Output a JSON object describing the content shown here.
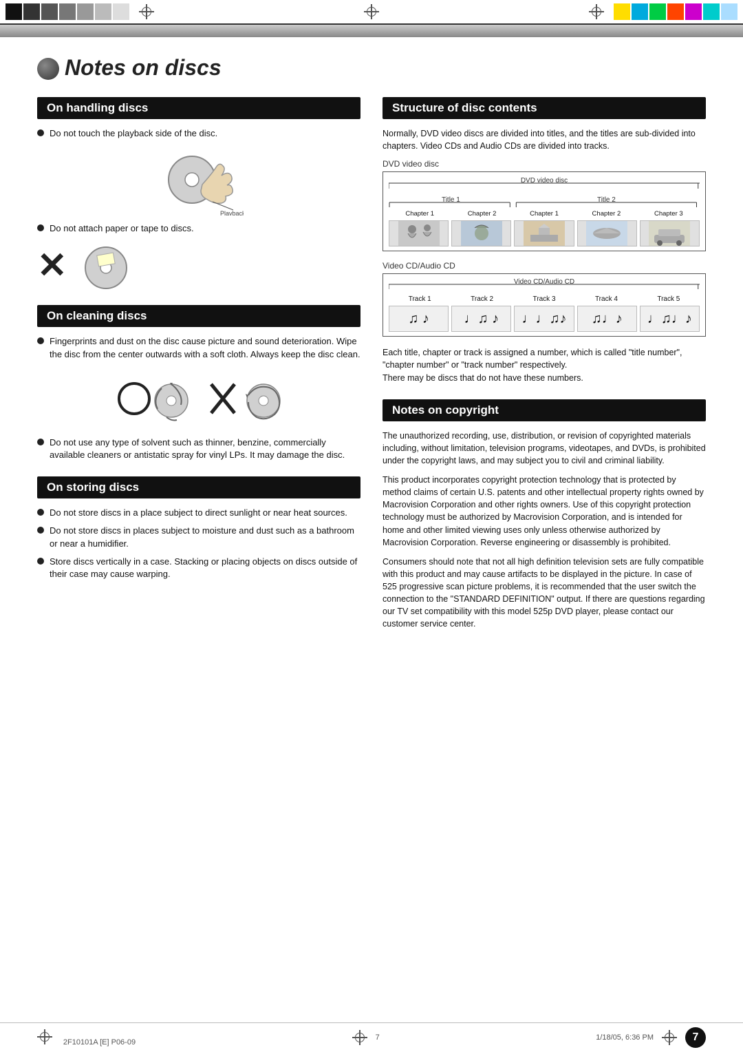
{
  "page": {
    "title": "Notes on discs",
    "page_number": "7",
    "footer_left": "2F10101A [E] P06-09",
    "footer_center": "7",
    "footer_right": "1/18/05, 6:36 PM"
  },
  "colors": {
    "top_bar": [
      "#111111",
      "#333333",
      "#555555",
      "#888888",
      "#aaaaaa",
      "#cccccc",
      "#ffcc00",
      "#00aaff",
      "#00cc44",
      "#ff4400",
      "#cc00cc",
      "#00cccc",
      "#aaddff"
    ]
  },
  "left_column": {
    "handling": {
      "header": "On handling discs",
      "bullet1": "Do not touch the playback side of the disc.",
      "playback_label": "Playback side",
      "bullet2": "Do not attach paper or tape to discs."
    },
    "cleaning": {
      "header": "On cleaning discs",
      "bullet1": "Fingerprints and dust on the disc cause picture and sound deterioration. Wipe the disc from the center outwards with a soft cloth. Always keep the disc clean.",
      "bullet2": "Do not use any type of solvent such as thinner, benzine, commercially available cleaners or antistatic spray for vinyl LPs. It may damage the disc."
    },
    "storing": {
      "header": "On storing discs",
      "bullet1": "Do not store discs in a place subject to direct sunlight or near heat sources.",
      "bullet2": "Do not store discs in places subject to moisture and dust such as a bathroom or near a humidifier.",
      "bullet3": "Store discs vertically in a case. Stacking or placing objects on discs outside of their case may cause warping."
    }
  },
  "right_column": {
    "structure": {
      "header": "Structure of disc contents",
      "desc": "Normally, DVD video discs are divided into titles, and the titles are sub-divided into chapters. Video CDs and Audio CDs are divided into tracks.",
      "dvd_label": "DVD video disc",
      "dvd_inner_label": "DVD video disc",
      "title1": "Title 1",
      "title2": "Title 2",
      "chapters_dvd": [
        "Chapter 1",
        "Chapter 2",
        "Chapter 1",
        "Chapter 2",
        "Chapter 3"
      ],
      "cd_label": "Video CD/Audio CD",
      "cd_inner_label": "Video CD/Audio CD",
      "tracks": [
        "Track 1",
        "Track 2",
        "Track 3",
        "Track 4",
        "Track 5"
      ],
      "desc2": "Each title, chapter or track is assigned a number, which is called \"title number\", \"chapter number\" or \"track number\" respectively.",
      "desc3": "There may be discs that do not have these numbers."
    },
    "copyright": {
      "header": "Notes on copyright",
      "para1": "The unauthorized recording, use, distribution, or revision of copyrighted materials including, without limitation, television programs, videotapes, and DVDs, is prohibited under the copyright laws, and may subject you to civil and criminal liability.",
      "para2": "This product incorporates copyright protection technology that is protected by method claims of certain U.S. patents and other intellectual property rights owned by Macrovision Corporation and other rights owners. Use of this copyright protection technology must be authorized by Macrovision Corporation, and is intended for home and other limited viewing uses only unless otherwise authorized by Macrovision Corporation. Reverse engineering or disassembly is prohibited.",
      "para3": "Consumers should note that not all high definition television sets are fully compatible with this product and may cause artifacts to be displayed in the picture. In case of 525 progressive scan picture problems, it is recommended that the user switch the connection to the \"STANDARD DEFINITION\" output. If there are questions regarding our TV set compatibility with this model 525p DVD player, please contact our customer service center."
    }
  }
}
